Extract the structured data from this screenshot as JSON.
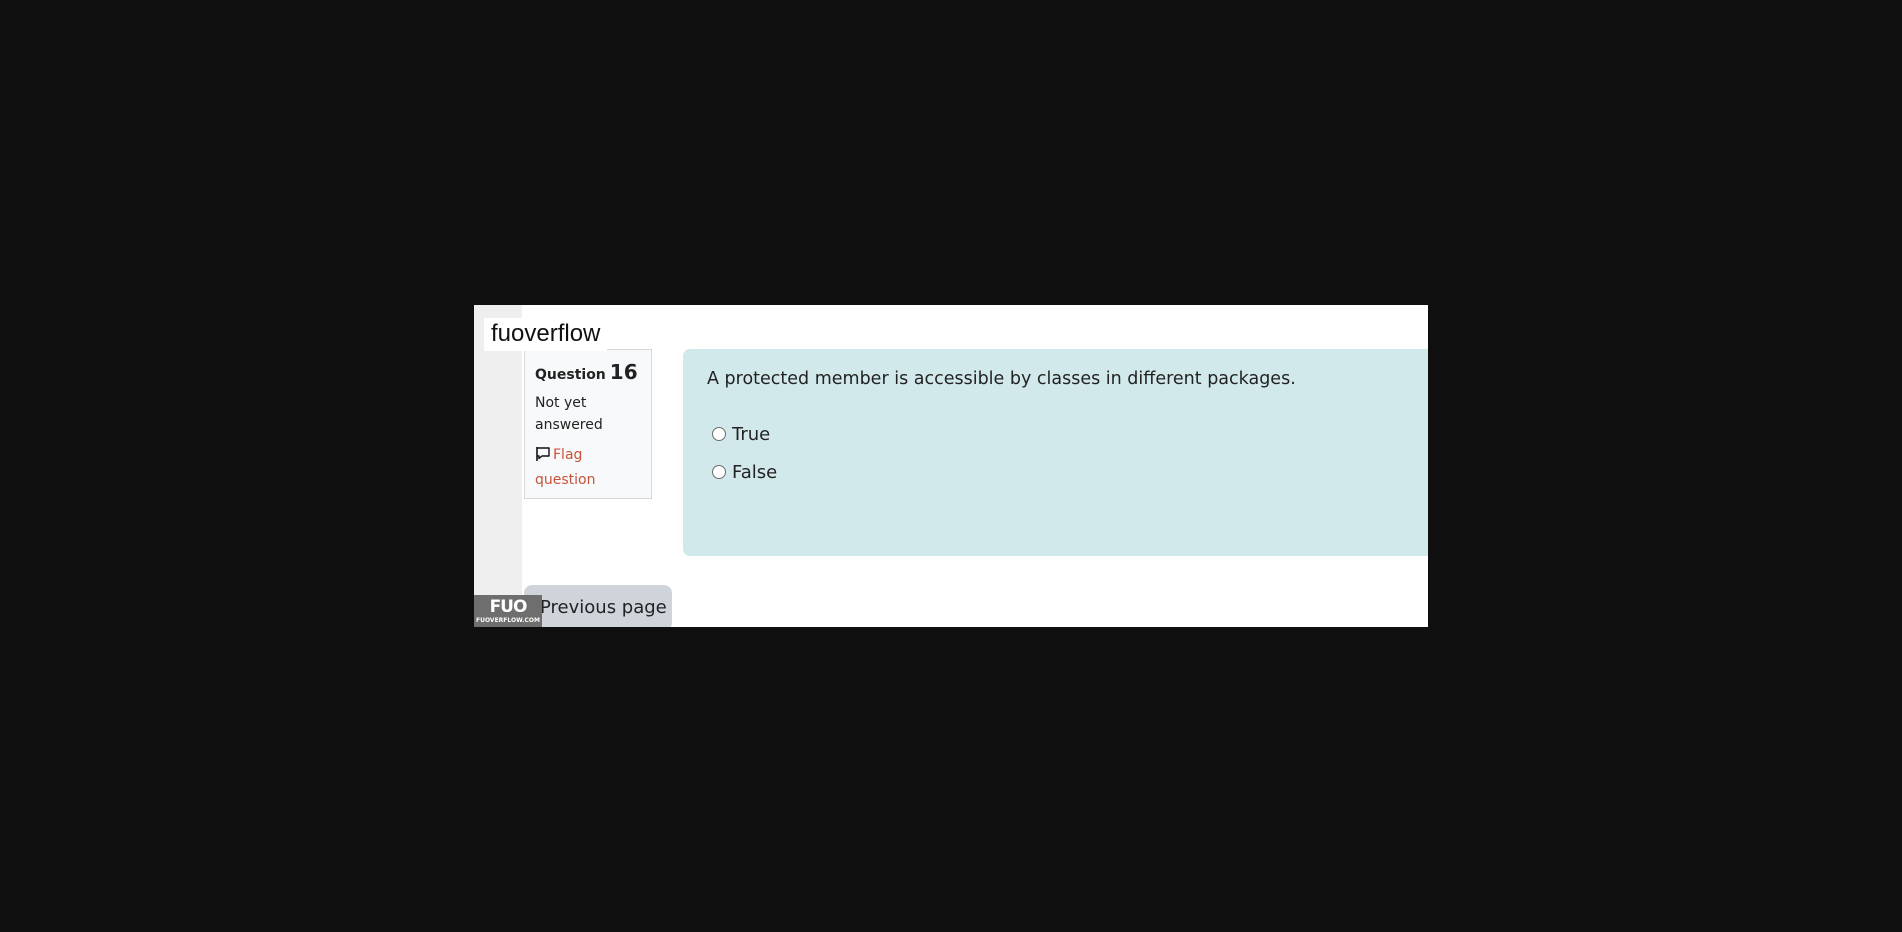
{
  "watermark": {
    "brand": "fuoverflow",
    "logo_mark": "FUO",
    "logo_sub": "FUOVERFLOW.COM"
  },
  "question_info": {
    "label": "Question",
    "number": "16",
    "state": "Not yet answered",
    "flag_label": "Flag question"
  },
  "question": {
    "text": "A protected member is accessible by classes in different packages.",
    "options": [
      {
        "label": "True",
        "selected": false
      },
      {
        "label": "False",
        "selected": false
      }
    ]
  },
  "navigation": {
    "previous_label": "Previous page"
  },
  "colors": {
    "page_background": "#0f0f0f",
    "question_box": "#d2e9ec",
    "flag_link": "#c7533a",
    "button": "#ced4da"
  }
}
